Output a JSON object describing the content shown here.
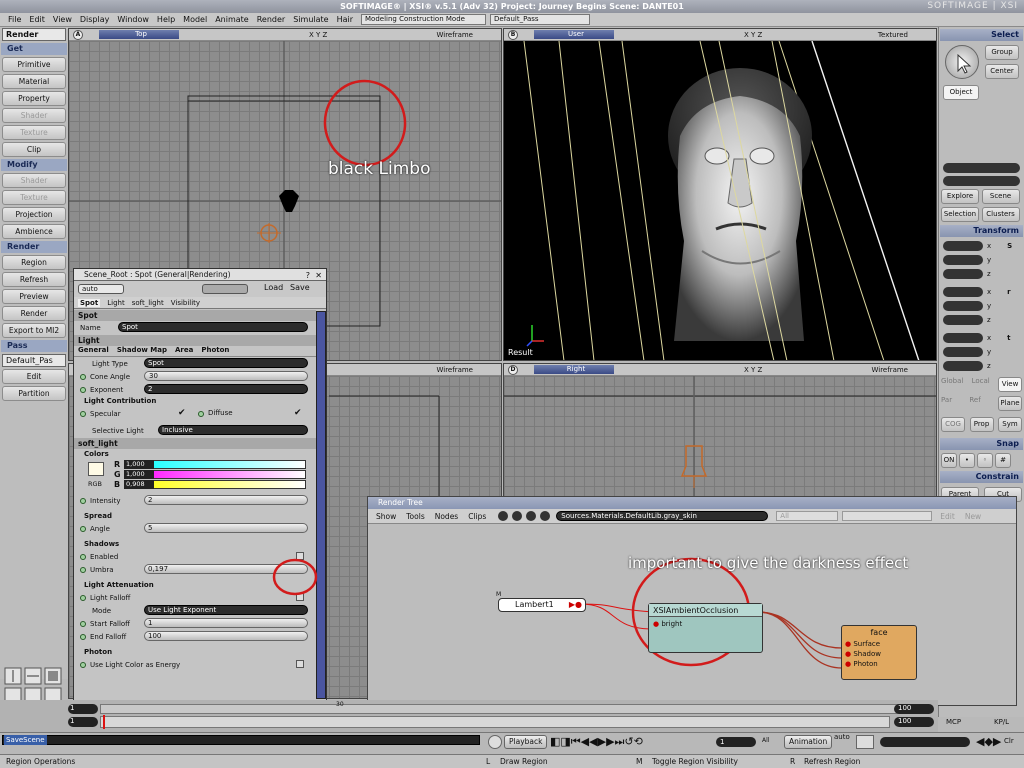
{
  "window": {
    "title": "SOFTIMAGE® | XSI® v.5.1 (Adv 32) Project: Journey Begins    Scene: DANTE01",
    "brand": "SOFTIMAGE | XSI"
  },
  "menu": {
    "items": [
      "File",
      "Edit",
      "View",
      "Display",
      "Window",
      "Help",
      "Model",
      "Animate",
      "Render",
      "Simulate",
      "Hair"
    ],
    "construction_mode": "Modeling Construction Mode",
    "pass": "Default_Pass"
  },
  "left_toolbar": {
    "module": "Render",
    "sections": [
      {
        "header": "Get",
        "buttons": [
          {
            "label": "Primitive",
            "enabled": true
          },
          {
            "label": "Material",
            "enabled": true
          },
          {
            "label": "Property",
            "enabled": true
          },
          {
            "label": "Shader",
            "enabled": false
          },
          {
            "label": "Texture",
            "enabled": false
          },
          {
            "label": "Clip",
            "enabled": true
          }
        ]
      },
      {
        "header": "Modify",
        "buttons": [
          {
            "label": "Shader",
            "enabled": false
          },
          {
            "label": "Texture",
            "enabled": false
          },
          {
            "label": "Projection",
            "enabled": true
          },
          {
            "label": "Ambience",
            "enabled": true
          }
        ]
      },
      {
        "header": "Render",
        "buttons": [
          {
            "label": "Region",
            "enabled": true
          },
          {
            "label": "Refresh",
            "enabled": true
          },
          {
            "label": "Preview",
            "enabled": true
          },
          {
            "label": "Render",
            "enabled": true
          },
          {
            "label": "Export to MI2",
            "enabled": true
          }
        ]
      },
      {
        "header": "Pass",
        "pass_value": "Default_Pas",
        "buttons": [
          {
            "label": "Edit",
            "enabled": true
          },
          {
            "label": "Partition",
            "enabled": true
          }
        ]
      }
    ]
  },
  "viewports": {
    "a": {
      "letter": "A",
      "name": "Top",
      "axes": "X Y Z",
      "mode": "Wireframe"
    },
    "b": {
      "letter": "B",
      "name": "User",
      "axes": "X Y Z",
      "mode": "Textured",
      "overlay": "Result"
    },
    "c": {
      "mode": "Wireframe"
    },
    "d": {
      "letter": "D",
      "name": "Right",
      "axes": "X Y Z",
      "mode": "Wireframe"
    }
  },
  "annotations": {
    "limbo": "black Limbo",
    "darkness": "important to give the darkness effect"
  },
  "property_panel": {
    "title": "Scene_Root : Spot (General|Rendering)",
    "preset": "auto",
    "load": "Load",
    "save": "Save",
    "tabs": [
      "Spot",
      "Light",
      "soft_light",
      "Visibility"
    ],
    "spot_section": "Spot",
    "name_label": "Name",
    "name_value": "Spot",
    "light_section": "Light",
    "light_tabs": [
      "General",
      "Shadow Map",
      "Area",
      "Photon"
    ],
    "light_type_label": "Light Type",
    "light_type_value": "Spot",
    "cone_angle_label": "Cone Angle",
    "cone_angle_value": "30",
    "exponent_label": "Exponent",
    "exponent_value": "2",
    "contribution_label": "Light Contribution",
    "specular_label": "Specular",
    "diffuse_label": "Diffuse",
    "selective_label": "Selective Light",
    "selective_value": "Inclusive",
    "soft_light_section": "soft_light",
    "colors_label": "Colors",
    "r_label": "R",
    "r_value": "1,000",
    "g_label": "G",
    "g_value": "1,000",
    "b_label": "B",
    "b_value": "0,908",
    "rgb_label": "RGB",
    "intensity_label": "Intensity",
    "intensity_value": "2",
    "spread_label": "Spread",
    "angle_label": "Angle",
    "angle_value": "5",
    "shadows_label": "Shadows",
    "enabled_label": "Enabled",
    "umbra_label": "Umbra",
    "umbra_value": "0,197",
    "attenuation_label": "Light Attenuation",
    "falloff_label": "Light Falloff",
    "mode_label": "Mode",
    "mode_value": "Use Light Exponent",
    "start_label": "Start Falloff",
    "start_value": "1",
    "end_label": "End Falloff",
    "end_value": "100",
    "photon_label": "Photon",
    "energy_label": "Use Light Color as Energy"
  },
  "render_tree": {
    "title": "Render Tree",
    "menus": [
      "Show",
      "Tools",
      "Nodes",
      "Clips"
    ],
    "path": "Sources.Materials.DefaultLib.gray_skin",
    "filter": "All",
    "edit": "Edit",
    "new": "New",
    "nodes": {
      "lambert": {
        "name": "Lambert1",
        "marker": "M"
      },
      "occlusion": {
        "name": "XSIAmbientOcclusion",
        "port": "bright"
      },
      "face": {
        "name": "face",
        "ports": [
          "Surface",
          "Shadow",
          "Photon"
        ]
      }
    }
  },
  "right_panel": {
    "select": "Select",
    "group": "Group",
    "center": "Center",
    "object": "Object",
    "explore": "Explore",
    "scene": "Scene",
    "selection": "Selection",
    "clusters": "Clusters",
    "transform": "Transform",
    "axes": [
      "x",
      "y",
      "z",
      "x",
      "y",
      "z",
      "x",
      "y",
      "z"
    ],
    "ref_modes": [
      "Global",
      "Local",
      "View"
    ],
    "ref_modes2": [
      "Par",
      "Ref",
      "Plane"
    ],
    "cog": "COG",
    "prop": "Prop",
    "sym": "Sym",
    "snap": "Snap",
    "on": "ON",
    "constrain": "Constrain",
    "parent": "Parent",
    "cut": "Cut",
    "mcp": "MCP",
    "kpl": "KP/L"
  },
  "timeline": {
    "start": "1",
    "end": "100",
    "current": "1",
    "tick": "30",
    "end2": "100"
  },
  "playback": {
    "label": "Playback",
    "all": "All",
    "animation": "Animation",
    "auto": "auto",
    "clr": "Clr",
    "frame": "1"
  },
  "command": {
    "value": "SaveScene"
  },
  "status": {
    "left": "Region Operations",
    "l": "Draw Region",
    "m": "Toggle Region Visibility",
    "r": "Refresh Region",
    "l_key": "L",
    "m_key": "M",
    "r_key": "R"
  }
}
